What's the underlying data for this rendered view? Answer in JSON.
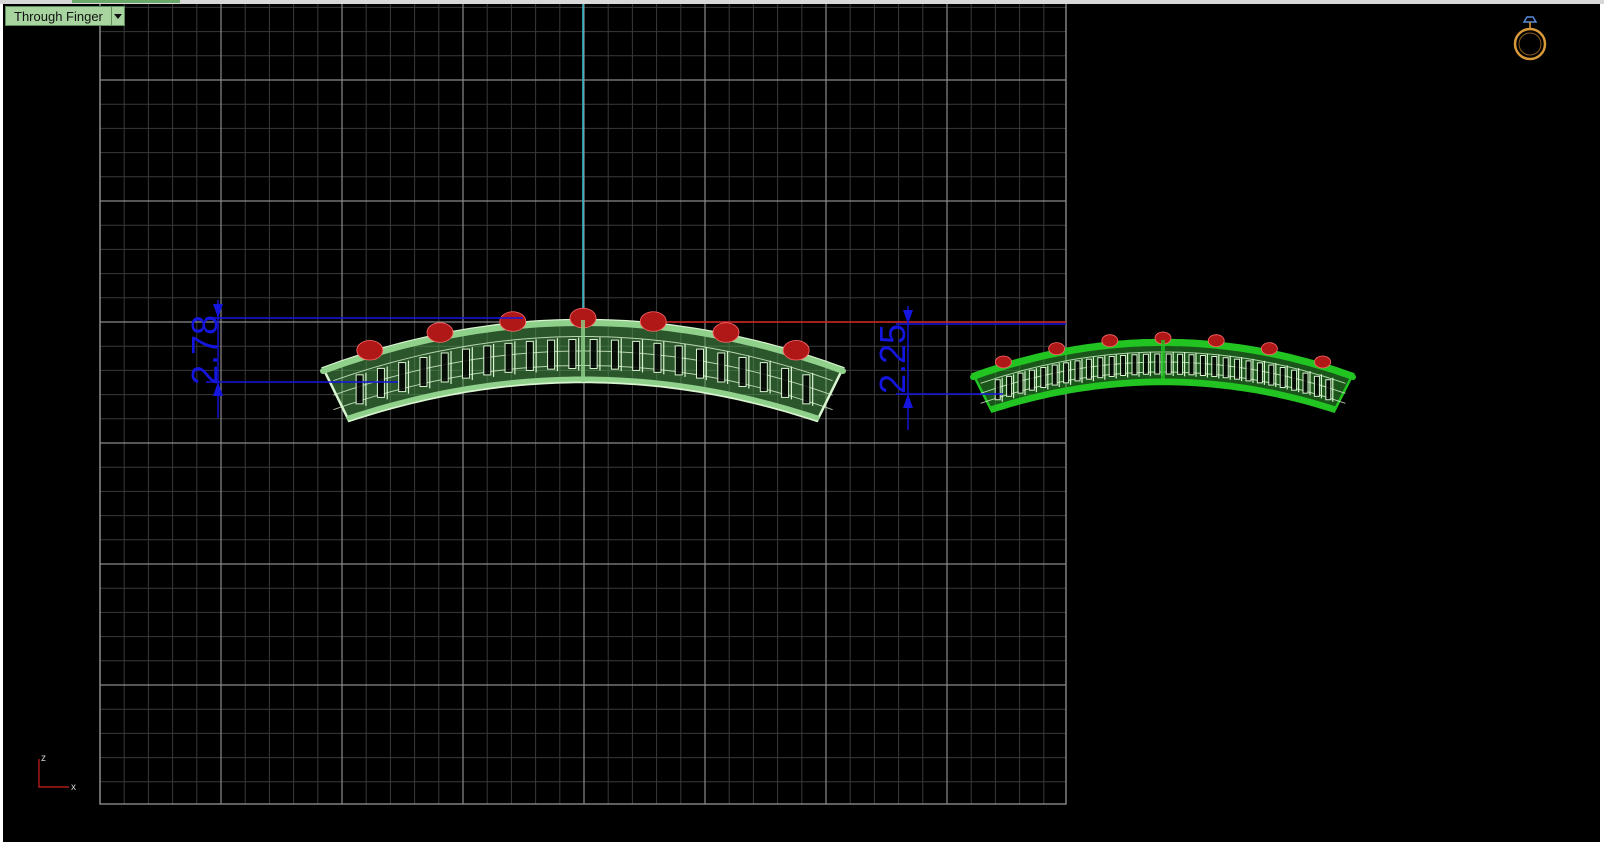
{
  "viewport": {
    "view_name": "Through Finger",
    "background": "#000000"
  },
  "dimensions": [
    {
      "id": "left-height",
      "value": "2.78"
    },
    {
      "id": "right-height",
      "value": "2.25"
    }
  ],
  "axis_indicator": {
    "vertical": "z",
    "horizontal": "x"
  },
  "colors": {
    "grid_minor": "#3a3a3a",
    "grid_major": "#8a8a8a",
    "axis_vertical": "#39b6c6",
    "axis_horizontal": "#cc1f1f",
    "dimension": "#1515e0",
    "band_wire": "#d8f5d0",
    "band_fill": "#4e9a4e",
    "band_selected": "#22c422",
    "gem": "#b01818",
    "ring_icon": "#d89a3a"
  },
  "icons": [
    "ring-view-icon",
    "dropdown-arrow-icon"
  ]
}
